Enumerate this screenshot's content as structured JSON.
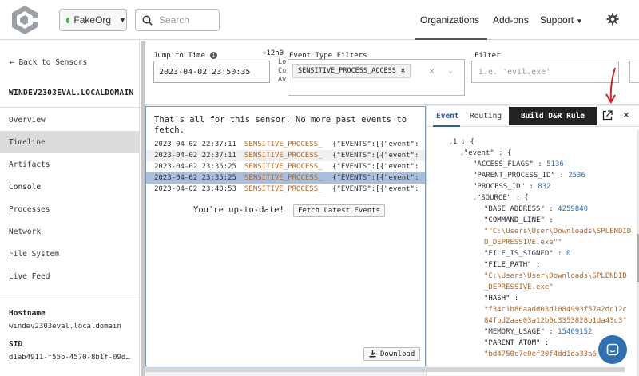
{
  "header": {
    "org_name": "FakeOrg",
    "search_placeholder": "Search",
    "nav": {
      "organizations": "Organizations",
      "addons": "Add-ons",
      "support": "Support"
    }
  },
  "sidebar": {
    "back_label": "← Back to Sensors",
    "hostname_title": "WINDEV2303EVAL.LOCALDOMAIN",
    "items": [
      {
        "label": "Overview"
      },
      {
        "label": "Timeline"
      },
      {
        "label": "Artifacts"
      },
      {
        "label": "Console"
      },
      {
        "label": "Processes"
      },
      {
        "label": "Network"
      },
      {
        "label": "File System"
      },
      {
        "label": "Live Feed"
      }
    ],
    "meta": {
      "hostname_label": "Hostname",
      "hostname_value": "windev2303eval.localdomain",
      "sid_label": "SID",
      "sid_value": "d1ab4911-f55b-4570-8b1f-09d…"
    }
  },
  "filters": {
    "jump_label": "Jump to Time",
    "time_value": "2023-04-02 23:50:35",
    "offset": "+12h0",
    "cut_text_lines": [
      "Lo",
      "Co",
      "Av"
    ],
    "event_type_label": "Event Type Filters",
    "event_type_tag": "SENSITIVE_PROCESS_ACCESS",
    "filter_label": "Filter",
    "filter_placeholder": "i.e. 'evil.exe'"
  },
  "timeline": {
    "end_message": "That's all for this sensor! No more past events to fetch.",
    "events": [
      {
        "time": "2023-04-02 22:37:11",
        "type": "SENSITIVE_PROCESS_",
        "payload": "{\"EVENTS\":[{\"event\":"
      },
      {
        "time": "2023-04-02 22:37:11",
        "type": "SENSITIVE_PROCESS_",
        "payload": "{\"EVENTS\":[{\"event\":"
      },
      {
        "time": "2023-04-02 23:35:25",
        "type": "SENSITIVE_PROCESS_",
        "payload": "{\"EVENTS\":[{\"event\":"
      },
      {
        "time": "2023-04-02 23:35:25",
        "type": "SENSITIVE_PROCESS_",
        "payload": "{\"EVENTS\":[{\"event\":"
      },
      {
        "time": "2023-04-02 23:40:53",
        "type": "SENSITIVE_PROCESS_",
        "payload": "{\"EVENTS\":[{\"event\":"
      }
    ],
    "uptodate": "You're up-to-date!",
    "fetch_label": "Fetch Latest Events",
    "download_label": "Download"
  },
  "detail": {
    "tab_event": "Event",
    "tab_routing": "Routing",
    "tooltip": "Build D&R Rule",
    "json": {
      "root_index": "1 : {",
      "event_key": "\"event\" : {",
      "access_flags_key": "\"ACCESS_FLAGS\" :",
      "access_flags_val": "5136",
      "parent_pid_key": "\"PARENT_PROCESS_ID\" :",
      "parent_pid_val": "2536",
      "pid_key": "\"PROCESS_ID\" :",
      "pid_val": "832",
      "source_key": "\"SOURCE\" : {",
      "base_address_key": "\"BASE_ADDRESS\" :",
      "base_address_val": "4259840",
      "cmdline_key": "\"COMMAND_LINE\" :",
      "cmdline_val_1": "\"\"C:\\Users\\User\\Downloads\\SPLENDID",
      "cmdline_val_2": "D_DEPRESSIVE.exe\"\"",
      "signed_key": "\"FILE_IS_SIGNED\" :",
      "signed_val": "0",
      "filepath_key": "\"FILE_PATH\" :",
      "filepath_val_1": "\"C:\\Users\\User\\Downloads\\SPLENDID",
      "filepath_val_2": "_DEPRESSIVE.exe\"",
      "hash_key": "\"HASH\" :",
      "hash_val_1": "\"f34c1b86aadd03d1084993f57a2dc12c",
      "hash_val_2": "84fbd2aae03a12b0c3353828b1da43c3\"",
      "mem_key": "\"MEMORY_USAGE\" :",
      "mem_val": "15409152",
      "parent_atom_key": "\"PARENT_ATOM\" :",
      "parent_atom_val": "\"bd4750c7e0ef20f4dd1da33a6"
    }
  },
  "colors": {
    "accent": "#2b5fa6",
    "selected_row": "#a9c0dd",
    "string": "#b5651d",
    "number": "#2b6cb0",
    "annotation_arrow": "#d42020"
  }
}
